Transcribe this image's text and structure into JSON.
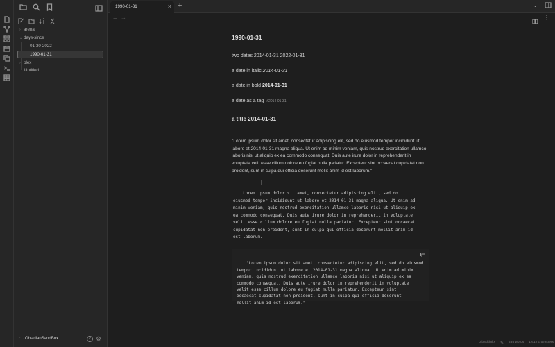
{
  "tab": {
    "title": "1990-01-31"
  },
  "tree": {
    "items": [
      {
        "label": "arena",
        "chevron": "›"
      },
      {
        "label": "days-since",
        "chevron": "⌄"
      },
      {
        "label": "01-30-2022",
        "chevron": ""
      },
      {
        "label": "1990-01-31",
        "chevron": ""
      },
      {
        "label": "plex",
        "chevron": "›"
      },
      {
        "label": "Untitled",
        "chevron": ""
      }
    ]
  },
  "vault": {
    "name": "ObsidianSandBox",
    "help": "?",
    "gear": "⚙",
    "chevrons": "⌃⌄"
  },
  "note": {
    "title": "1990-01-31",
    "line1": "two dates 2014-01-31 2022-01-31",
    "line2_prefix": "a date in italic ",
    "line2_date": "2014-01-31",
    "line3_prefix": "a date in bold ",
    "line3_date": "2014-01-31",
    "line4_prefix": "a date as a tag ",
    "line4_tag": "#2014-01-31",
    "subtitle": "a title 2014-01-31",
    "paragraph": "\"Lorem ipsum dolor sit amet, consectetur adipiscing elit, sed do eiusmod tempor incididunt ut labore et 2014-01-31 magna aliqua. Ut enim ad minim veniam, quis nostrud exercitation ullamco laboris nisi ut aliquip ex ea commodo consequat. Duis aute irure dolor in reprehenderit in voluptate velit esse cillum dolore eu fugiat nulla pariatur. Excepteur sint occaecat cupidatat non proident, sunt in culpa qui officia deserunt mollit anim id est laborum.\"",
    "code_indented": "    Lorem ipsum dolor sit amet, consectetur adipiscing elit, sed do\neiusmod tempor incididunt ut labore et 2014-01-31 magna aliqua. Ut enim ad\nminim veniam, quis nostrud exercitation ullamco laboris nisi ut aliquip ex\nea commodo consequat. Duis aute irure dolor in reprehenderit in voluptate\nvelit esse cillum dolore eu fugiat nulla pariatur. Excepteur sint occaecat\ncupidatat non proident, sunt in culpa qui officia deserunt mollit anim id\nest laborum.",
    "code_block": "\"Lorem ipsum dolor sit amet, consectetur adipiscing elit, sed do eiusmod\ntempor incididunt ut labore et 2014-01-31 magna aliqua. Ut enim ad minim\nveniam, quis nostrud exercitation ullamco laboris nisi ut aliquip ex ea\ncommodo consequat. Duis aute irure dolor in reprehenderit in voluptate\nvelit esse cillum dolore eu fugiat nulla pariatur. Excepteur sint\noccaecat cupidatat non proident, sunt in culpa qui officia deserunt\nmollit anim id est laborum.\""
  },
  "status": {
    "backlinks": "0 backlinks",
    "words": "235 words",
    "chars": "1,612 characters"
  },
  "ui": {
    "tab_close": "×",
    "new_tab": "+",
    "back": "←",
    "forward": "→",
    "more": "⋮",
    "chevron_down": "⌄"
  }
}
